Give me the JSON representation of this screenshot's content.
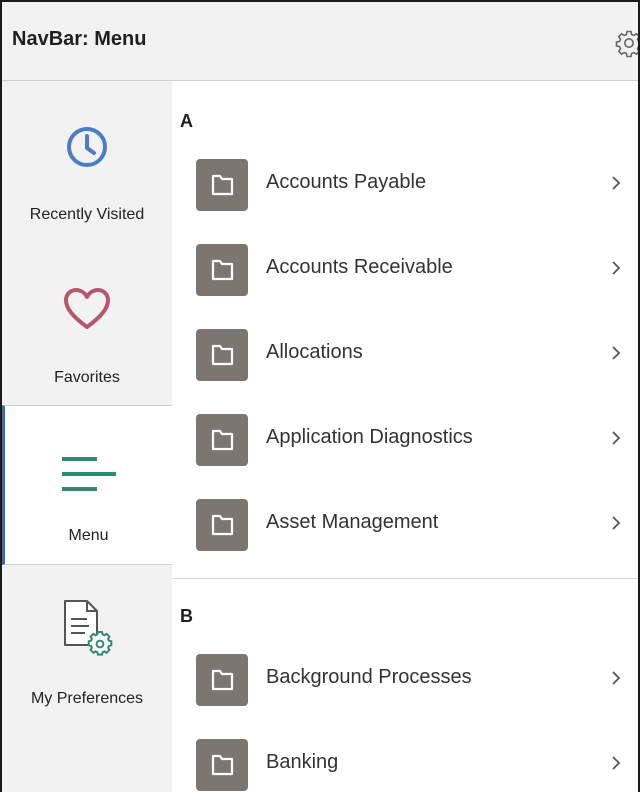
{
  "header": {
    "title": "NavBar: Menu",
    "settings_icon": "gear-icon"
  },
  "sidebar": {
    "items": [
      {
        "label": "Recently Visited",
        "icon": "clock-icon",
        "color": "#4a7ec2"
      },
      {
        "label": "Favorites",
        "icon": "heart-icon",
        "color": "#b5566d"
      },
      {
        "label": "Menu",
        "icon": "menu-lines-icon",
        "color": "#2e8a72",
        "active": true
      },
      {
        "label": "My Preferences",
        "icon": "document-gear-icon",
        "color": "#555555"
      }
    ]
  },
  "menu": {
    "groups": [
      {
        "letter": "A",
        "items": [
          {
            "label": "Accounts Payable"
          },
          {
            "label": "Accounts Receivable"
          },
          {
            "label": "Allocations"
          },
          {
            "label": "Application Diagnostics"
          },
          {
            "label": "Asset Management"
          }
        ]
      },
      {
        "letter": "B",
        "items": [
          {
            "label": "Background Processes"
          },
          {
            "label": "Banking"
          }
        ]
      }
    ]
  },
  "colors": {
    "folder": "#7c7670",
    "active_border": "#3f6aa3"
  }
}
